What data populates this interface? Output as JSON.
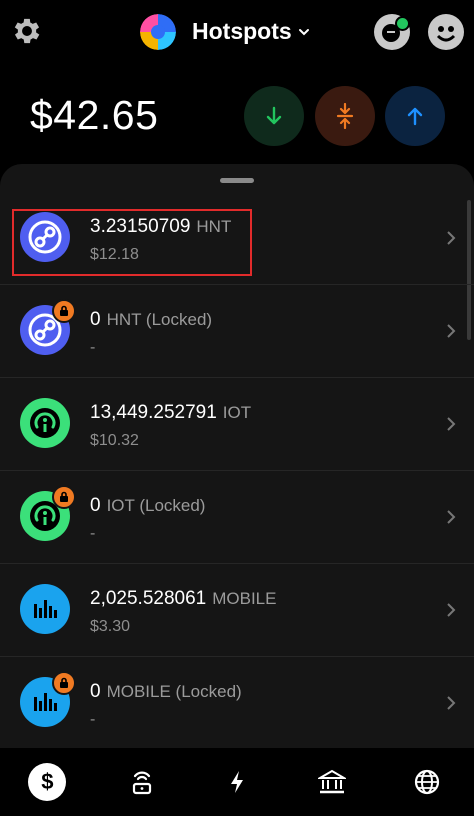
{
  "header": {
    "title": "Hotspots",
    "icons": {
      "settings": "gear-icon",
      "logo": "wallet-logo-icon",
      "dropdown": "chevron-down-icon",
      "notifications": "notification-icon",
      "account": "account-icon"
    }
  },
  "balance": {
    "total": "$42.65"
  },
  "actions": [
    {
      "name": "receive",
      "icon": "arrow-down-icon",
      "color": "#22c55e"
    },
    {
      "name": "swap",
      "icon": "swap-icon",
      "color": "#f07a22"
    },
    {
      "name": "send",
      "icon": "arrow-up-icon",
      "color": "#1e90ff"
    }
  ],
  "tokens": [
    {
      "amount": "3.23150709",
      "symbol": "HNT",
      "value": "$12.18",
      "icon": "hnt-icon",
      "locked": false,
      "highlighted": true
    },
    {
      "amount": "0",
      "symbol": "HNT (Locked)",
      "value": "-",
      "icon": "hnt-icon",
      "locked": true
    },
    {
      "amount": "13,449.252791",
      "symbol": "IOT",
      "value": "$10.32",
      "icon": "iot-icon",
      "locked": false
    },
    {
      "amount": "0",
      "symbol": "IOT (Locked)",
      "value": "-",
      "icon": "iot-icon",
      "locked": true
    },
    {
      "amount": "2,025.528061",
      "symbol": "MOBILE",
      "value": "$3.30",
      "icon": "mobile-icon",
      "locked": false
    },
    {
      "amount": "0",
      "symbol": "MOBILE (Locked)",
      "value": "-",
      "icon": "mobile-icon",
      "locked": true
    }
  ],
  "bottom_nav": {
    "active_label": "$",
    "items": [
      "dollar-icon",
      "hotspot-icon",
      "lightning-icon",
      "governance-icon",
      "globe-icon"
    ]
  },
  "colors": {
    "hnt": "#4f5ef0",
    "iot": "#3be07a",
    "mobile": "#1aa3ee",
    "lock": "#f07a22",
    "highlight": "#e22b2b"
  }
}
